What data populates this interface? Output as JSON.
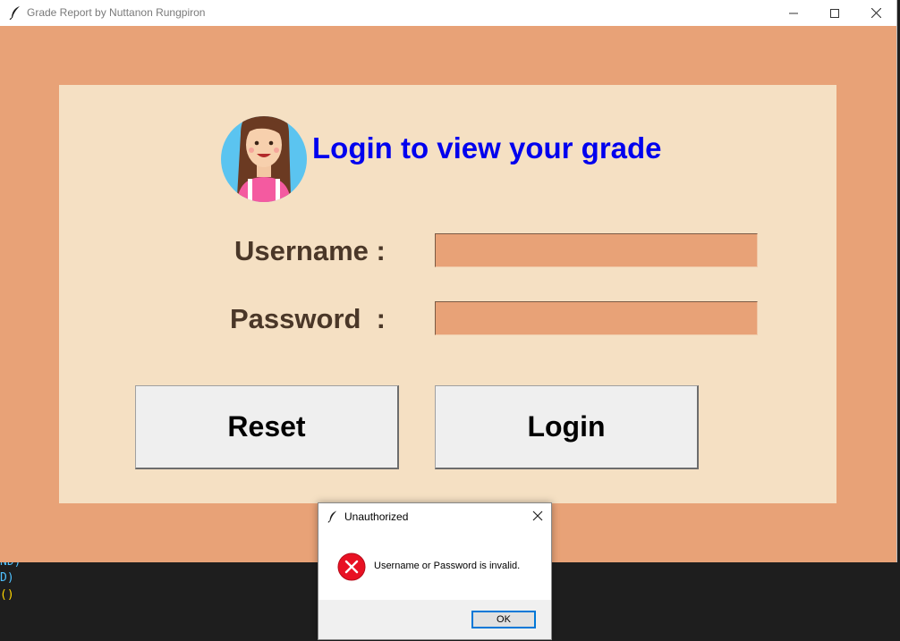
{
  "window": {
    "title": "Grade Report by Nuttanon Rungpiron",
    "icons": [
      "feather-icon",
      "minimize-icon",
      "maximize-icon",
      "close-icon"
    ]
  },
  "login": {
    "heading": "Login to view your grade",
    "username_label": "Username :",
    "password_label": "Password  :",
    "username_value": "",
    "password_value": "",
    "reset_label": "Reset",
    "login_label": "Login"
  },
  "dialog": {
    "title": "Unauthorized",
    "message": "Username or Password is invalid.",
    "ok_label": "OK",
    "icon": "error-icon"
  },
  "background_code": {
    "lines": [
      "ND)",
      "D)",
      "()"
    ]
  },
  "colors": {
    "window_bg": "#e8a277",
    "panel_bg": "#f5e0c3",
    "heading": "#0000ee",
    "label": "#4a3728",
    "error": "#e81123",
    "dialog_accent": "#0078d7"
  }
}
